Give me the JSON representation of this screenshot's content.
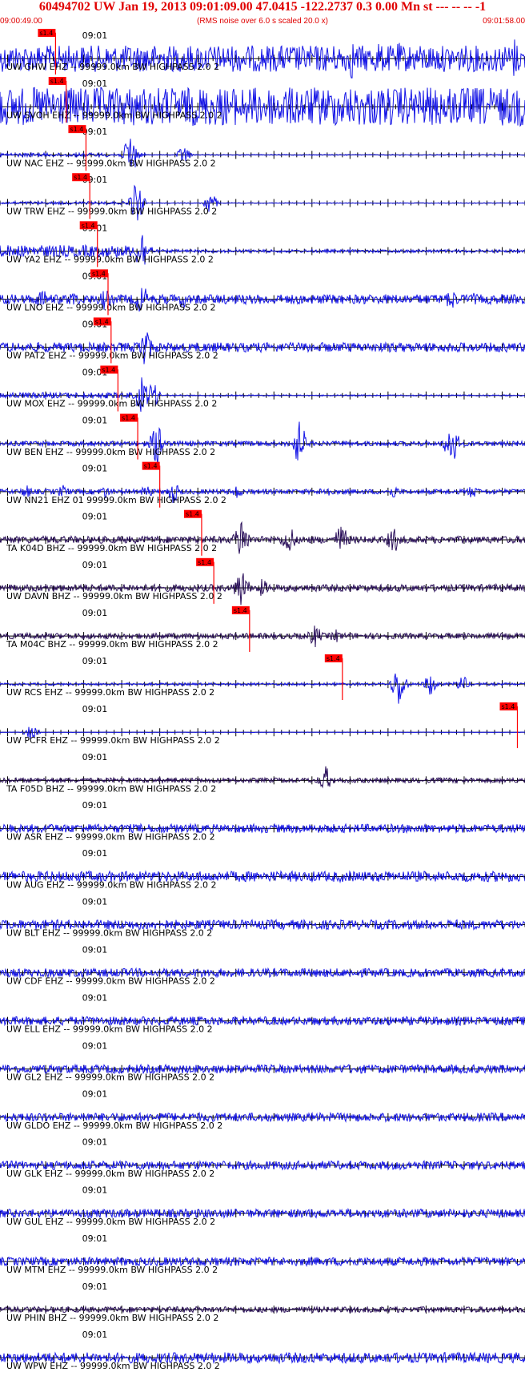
{
  "header": {
    "title": "60494702 UW Jan 19, 2013 09:01:09.00   47.0415 -122.2737  0.3 0.00 Mn st --- -- --  -1",
    "start_time": "09:00:49.00",
    "end_time": "09:01:58.00",
    "note": "(RMS noise over 6.0 s scaled 20.0 x)"
  },
  "colors": {
    "header_red": "#e00000",
    "trace_blue": "#1414e6",
    "trace_dark": "#2a0f5a",
    "pick_red": "#ff0000",
    "axis": "#000000"
  },
  "chart_data": {
    "type": "line",
    "title": "60494702 UW Jan 19, 2013 09:01:09.00   47.0415 -122.2737  0.3 0.00 Mn st --- -- --  -1",
    "x_range": [
      "09:00:49.00",
      "09:01:58.00"
    ],
    "tick_label": "09:01",
    "pick_tag": "s1.4",
    "traces": [
      {
        "label": "UW GHW EHZ -- 99999.0km BW  HIGHPASS  2.0  2",
        "pick": "09:00:56.3",
        "color": "blue",
        "amp": 0.55,
        "bursts": [
          [
            0.17,
            0.1
          ],
          [
            0.28,
            0.8
          ],
          [
            0.67,
            0.9
          ],
          [
            0.72,
            0.8
          ],
          [
            0.76,
            0.7
          ],
          [
            0.85,
            0.5
          ],
          [
            0.98,
            0.9
          ]
        ]
      },
      {
        "label": "UW SVOH EHZ -- 99999.0km BW  HIGHPASS  2.0  2",
        "pick": "09:00:57.7",
        "color": "blue",
        "amp": 0.8,
        "bursts": []
      },
      {
        "label": "UW NAC EHZ -- 99999.0km BW  HIGHPASS  2.0  2",
        "pick": "09:01:00.3",
        "color": "blue",
        "amp": 0.08,
        "bursts": [
          [
            0.25,
            1.0
          ],
          [
            0.35,
            0.4
          ]
        ],
        "quiet_after": 0.28
      },
      {
        "label": "UW TRW EHZ -- 99999.0km BW  HIGHPASS  2.0  2",
        "pick": "09:01:00.8",
        "color": "blue",
        "amp": 0.06,
        "bursts": [
          [
            0.26,
            0.9
          ],
          [
            0.4,
            0.5
          ]
        ],
        "quiet_after": 0.28
      },
      {
        "label": "UW YA2 EHZ -- 99999.0km BW  HIGHPASS  2.0  2",
        "pick": "09:01:01.8",
        "color": "blue",
        "amp": 0.25,
        "bursts": [
          [
            0.27,
            1.0
          ]
        ],
        "quiet_after": 0.29
      },
      {
        "label": "UW LNO EHZ -- 99999.0km BW  HIGHPASS  2.0  2",
        "pick": "09:01:03.2",
        "color": "blue",
        "amp": 0.2,
        "bursts": [
          [
            0.08,
            0.5
          ],
          [
            0.14,
            0.4
          ],
          [
            0.2,
            0.5
          ],
          [
            0.27,
            0.7
          ],
          [
            0.35,
            0.4
          ],
          [
            0.86,
            0.5
          ],
          [
            0.9,
            0.3
          ]
        ]
      },
      {
        "label": "UW PAT2 EHZ -- 99999.0km BW  HIGHPASS  2.0  2",
        "pick": "09:01:03.6",
        "color": "blue",
        "amp": 0.2,
        "bursts": [
          [
            0.275,
            1.0
          ]
        ]
      },
      {
        "label": "UW MOX EHZ -- 99999.0km BW  HIGHPASS  2.0  2",
        "pick": "09:01:04.5",
        "color": "blue",
        "amp": 0.12,
        "bursts": [
          [
            0.27,
            0.8
          ],
          [
            0.29,
            0.6
          ]
        ],
        "quiet_after": 0.3
      },
      {
        "label": "UW BEN EHZ -- 99999.0km BW  HIGHPASS  2.0  2",
        "pick": "09:01:07.1",
        "color": "blue",
        "amp": 0.1,
        "bursts": [
          [
            0.3,
            1.0
          ],
          [
            0.57,
            1.0
          ],
          [
            0.86,
            1.0
          ]
        ]
      },
      {
        "label": "UW NN21 EHZ 01 99999.0km BW  HIGHPASS  2.0  2",
        "pick": "09:01:10.0",
        "color": "blue",
        "amp": 0.1,
        "bursts": [
          [
            0.05,
            0.3
          ],
          [
            0.12,
            0.3
          ],
          [
            0.2,
            0.3
          ],
          [
            0.28,
            0.3
          ],
          [
            0.33,
            0.5
          ],
          [
            0.45,
            0.3
          ],
          [
            0.62,
            0.3
          ],
          [
            0.75,
            0.3
          ],
          [
            0.9,
            0.3
          ]
        ]
      },
      {
        "label": "TA K04D BHZ -- 99999.0km BW  HIGHPASS  2.0  2",
        "pick": "09:01:15.5",
        "color": "dark",
        "amp": 0.15,
        "bursts": [
          [
            0.46,
            1.0
          ],
          [
            0.55,
            0.7
          ],
          [
            0.65,
            0.7
          ],
          [
            0.75,
            0.6
          ]
        ]
      },
      {
        "label": "UW DAVN BHZ -- 99999.0km BW  HIGHPASS  2.0  2",
        "pick": "09:01:17.1",
        "color": "dark",
        "amp": 0.15,
        "bursts": [
          [
            0.46,
            0.9
          ],
          [
            0.5,
            0.4
          ]
        ]
      },
      {
        "label": "TA M04C BHZ -- 99999.0km BW  HIGHPASS  2.0  2",
        "pick": "09:01:21.8",
        "color": "dark",
        "amp": 0.12,
        "bursts": [
          [
            0.6,
            0.5
          ],
          [
            0.64,
            0.3
          ]
        ]
      },
      {
        "label": "UW RCS EHZ -- 99999.0km BW  HIGHPASS  2.0  2",
        "pick": "09:01:34.0",
        "color": "blue",
        "amp": 0.05,
        "bursts": [
          [
            0.76,
            1.0
          ],
          [
            0.82,
            0.5
          ],
          [
            0.88,
            0.4
          ]
        ]
      },
      {
        "label": "UW PCFR EHZ -- 99999.0km BW  HIGHPASS  2.0  2",
        "pick": "09:01:57.0",
        "color": "blue",
        "amp": 0.01,
        "bursts": [
          [
            0.06,
            0.3
          ]
        ],
        "flat": true
      },
      {
        "label": "TA F05D BHZ -- 99999.0km BW  HIGHPASS  2.0  2",
        "pick": null,
        "color": "dark",
        "amp": 0.1,
        "bursts": [
          [
            0.62,
            0.6
          ]
        ]
      },
      {
        "label": "UW ASR EHZ -- 99999.0km BW  HIGHPASS  2.0  2",
        "pick": null,
        "color": "blue",
        "amp": 0.18,
        "bursts": []
      },
      {
        "label": "UW AUG EHZ -- 99999.0km BW  HIGHPASS  2.0  2",
        "pick": null,
        "color": "blue",
        "amp": 0.22,
        "bursts": []
      },
      {
        "label": "UW BLT EHZ -- 99999.0km BW  HIGHPASS  2.0  2",
        "pick": null,
        "color": "blue",
        "amp": 0.2,
        "bursts": []
      },
      {
        "label": "UW CDF EHZ -- 99999.0km BW  HIGHPASS  2.0  2",
        "pick": null,
        "color": "blue",
        "amp": 0.18,
        "bursts": []
      },
      {
        "label": "UW ELL EHZ -- 99999.0km BW  HIGHPASS  2.0  2",
        "pick": null,
        "color": "blue",
        "amp": 0.18,
        "bursts": []
      },
      {
        "label": "UW GL2 EHZ -- 99999.0km BW  HIGHPASS  2.0  2",
        "pick": null,
        "color": "blue",
        "amp": 0.18,
        "bursts": []
      },
      {
        "label": "UW GLDO EHZ -- 99999.0km BW  HIGHPASS  2.0  2",
        "pick": null,
        "color": "blue",
        "amp": 0.18,
        "bursts": []
      },
      {
        "label": "UW GLK EHZ -- 99999.0km BW  HIGHPASS  2.0  2",
        "pick": null,
        "color": "blue",
        "amp": 0.18,
        "bursts": []
      },
      {
        "label": "UW GUL EHZ -- 99999.0km BW  HIGHPASS  2.0  2",
        "pick": null,
        "color": "blue",
        "amp": 0.18,
        "bursts": []
      },
      {
        "label": "UW MTM EHZ -- 99999.0km BW  HIGHPASS  2.0  2",
        "pick": null,
        "color": "blue",
        "amp": 0.18,
        "bursts": []
      },
      {
        "label": "UW PHIN BHZ -- 99999.0km BW  HIGHPASS  2.0  2",
        "pick": null,
        "color": "dark",
        "amp": 0.12,
        "bursts": []
      },
      {
        "label": "UW WPW EHZ -- 99999.0km BW  HIGHPASS  2.0  2",
        "pick": null,
        "color": "blue",
        "amp": 0.22,
        "bursts": []
      }
    ]
  }
}
